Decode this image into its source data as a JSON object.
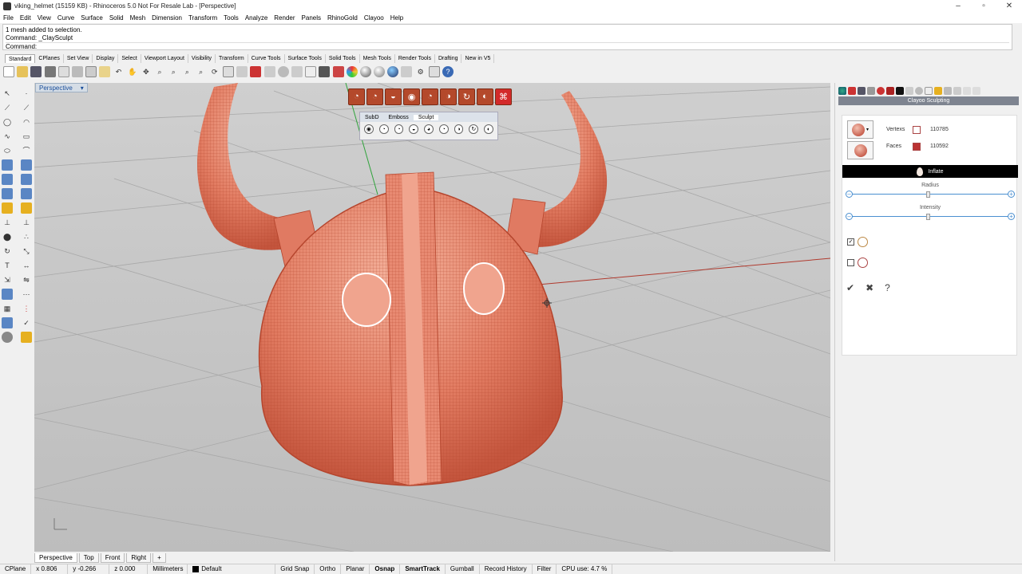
{
  "window": {
    "title": "viking_helmet (15159 KB) - Rhinoceros 5.0 Not For Resale Lab - [Perspective]",
    "controls": [
      "–",
      "▫",
      "✕"
    ]
  },
  "menu": [
    "File",
    "Edit",
    "View",
    "Curve",
    "Surface",
    "Solid",
    "Mesh",
    "Dimension",
    "Transform",
    "Tools",
    "Analyze",
    "Render",
    "Panels",
    "RhinoGold",
    "Clayoo",
    "Help"
  ],
  "command": {
    "history": [
      "1 mesh added to selection.",
      "Command: _ClaySculpt"
    ],
    "prompt": "Command:"
  },
  "toolbar_tabs": [
    "Standard",
    "CPlanes",
    "Set View",
    "Display",
    "Select",
    "Viewport Layout",
    "Visibility",
    "Transform",
    "Curve Tools",
    "Surface Tools",
    "Solid Tools",
    "Mesh Tools",
    "Render Tools",
    "Drafting",
    "New in V5"
  ],
  "viewport": {
    "name": "Perspective",
    "tabs": [
      "Perspective",
      "Top",
      "Front",
      "Right",
      "+"
    ]
  },
  "sculpt_panel": {
    "tabs": [
      "SubD",
      "Emboss",
      "Sculpt"
    ]
  },
  "right_panel": {
    "header": "Clayoo Sculpting",
    "vertex_label": "Vertexs",
    "vertex_count": "110785",
    "faces_label": "Faces",
    "faces_count": "110592",
    "tool": "Inflate",
    "radius_label": "Radius",
    "intensity_label": "Intensity",
    "radius_value": 0.49,
    "intensity_value": 0.49
  },
  "status": {
    "cplane": "CPlane",
    "x": "x 0.806",
    "y": "y -0.266",
    "z": "z 0.000",
    "units": "Millimeters",
    "layer": "Default",
    "toggles": [
      "Grid Snap",
      "Ortho",
      "Planar",
      "Osnap",
      "SmartTrack",
      "Gumball",
      "Record History",
      "Filter"
    ],
    "cpu": "CPU use: 4.7 %"
  },
  "colors": {
    "mesh": "#e07a62",
    "accent": "#4a8fd0",
    "viewport_bg": "#c6c6c6"
  }
}
